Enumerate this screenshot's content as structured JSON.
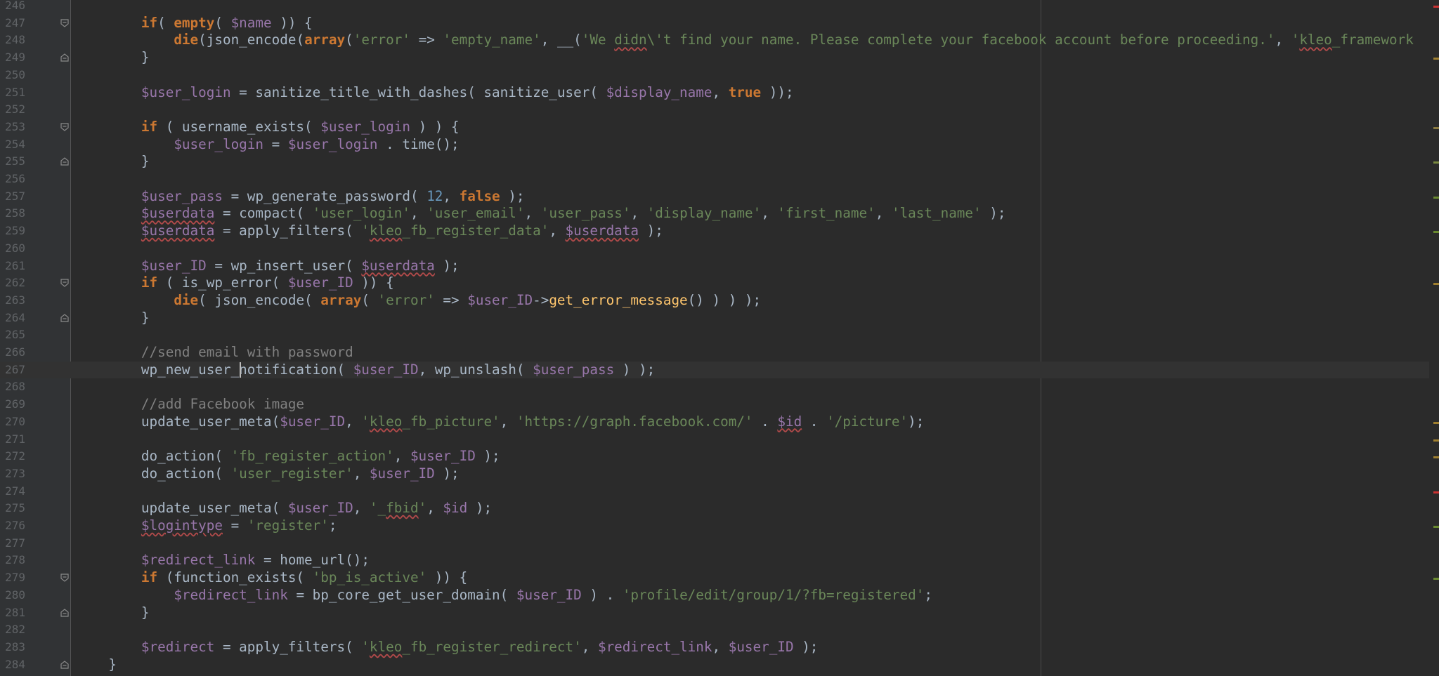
{
  "editor": {
    "lines": [
      {
        "n": "246",
        "fold": "",
        "tokens": []
      },
      {
        "n": "247",
        "fold": "open",
        "tokens": [
          [
            "pl",
            "        "
          ],
          [
            "kw",
            "if"
          ],
          [
            "pl",
            "( "
          ],
          [
            "kw",
            "empty"
          ],
          [
            "pl",
            "( "
          ],
          [
            "var",
            "$name"
          ],
          [
            "pl",
            " )) {"
          ]
        ]
      },
      {
        "n": "248",
        "fold": "",
        "tokens": [
          [
            "pl",
            "            "
          ],
          [
            "kw",
            "die"
          ],
          [
            "pl",
            "(json_encode("
          ],
          [
            "kw",
            "array"
          ],
          [
            "pl",
            "("
          ],
          [
            "str",
            "'error'"
          ],
          [
            "pl",
            " => "
          ],
          [
            "str",
            "'empty_name'"
          ],
          [
            "pl",
            ", __("
          ],
          [
            "str",
            "'We "
          ],
          [
            "str squig",
            "didn"
          ],
          [
            "str",
            "\\'t find your name. Please complete your facebook account before proceeding.'"
          ],
          [
            "pl",
            ", "
          ],
          [
            "str",
            "'"
          ],
          [
            "str squig",
            "kleo"
          ],
          [
            "str",
            "_framework"
          ]
        ]
      },
      {
        "n": "249",
        "fold": "close",
        "tokens": [
          [
            "pl",
            "        }"
          ]
        ]
      },
      {
        "n": "250",
        "fold": "",
        "tokens": []
      },
      {
        "n": "251",
        "fold": "",
        "tokens": [
          [
            "pl",
            "        "
          ],
          [
            "var",
            "$user_login"
          ],
          [
            "pl",
            " = sanitize_title_with_dashes( sanitize_user( "
          ],
          [
            "var",
            "$display_name"
          ],
          [
            "pl",
            ", "
          ],
          [
            "kw",
            "true"
          ],
          [
            "pl",
            " ));"
          ]
        ]
      },
      {
        "n": "252",
        "fold": "",
        "tokens": []
      },
      {
        "n": "253",
        "fold": "open",
        "tokens": [
          [
            "pl",
            "        "
          ],
          [
            "kw",
            "if"
          ],
          [
            "pl",
            " ( username_exists( "
          ],
          [
            "var",
            "$user_login"
          ],
          [
            "pl",
            " ) ) {"
          ]
        ]
      },
      {
        "n": "254",
        "fold": "",
        "tokens": [
          [
            "pl",
            "            "
          ],
          [
            "var",
            "$user_login"
          ],
          [
            "pl",
            " = "
          ],
          [
            "var",
            "$user_login"
          ],
          [
            "pl",
            " . time();"
          ]
        ]
      },
      {
        "n": "255",
        "fold": "close",
        "tokens": [
          [
            "pl",
            "        }"
          ]
        ]
      },
      {
        "n": "256",
        "fold": "",
        "tokens": []
      },
      {
        "n": "257",
        "fold": "",
        "tokens": [
          [
            "pl",
            "        "
          ],
          [
            "var",
            "$user_pass"
          ],
          [
            "pl",
            " = wp_generate_password( "
          ],
          [
            "num",
            "12"
          ],
          [
            "pl",
            ", "
          ],
          [
            "kw",
            "false"
          ],
          [
            "pl",
            " );"
          ]
        ]
      },
      {
        "n": "258",
        "fold": "",
        "tokens": [
          [
            "pl",
            "        "
          ],
          [
            "var squig",
            "$userdata"
          ],
          [
            "pl",
            " = compact( "
          ],
          [
            "str",
            "'user_login'"
          ],
          [
            "pl",
            ", "
          ],
          [
            "str",
            "'user_email'"
          ],
          [
            "pl",
            ", "
          ],
          [
            "str",
            "'user_pass'"
          ],
          [
            "pl",
            ", "
          ],
          [
            "str",
            "'display_name'"
          ],
          [
            "pl",
            ", "
          ],
          [
            "str",
            "'first_name'"
          ],
          [
            "pl",
            ", "
          ],
          [
            "str",
            "'last_name'"
          ],
          [
            "pl",
            " );"
          ]
        ]
      },
      {
        "n": "259",
        "fold": "",
        "tokens": [
          [
            "pl",
            "        "
          ],
          [
            "var squig",
            "$userdata"
          ],
          [
            "pl",
            " = apply_filters( "
          ],
          [
            "str",
            "'"
          ],
          [
            "str squig",
            "kleo"
          ],
          [
            "str",
            "_fb_register_data'"
          ],
          [
            "pl",
            ", "
          ],
          [
            "var squig",
            "$userdata"
          ],
          [
            "pl",
            " );"
          ]
        ]
      },
      {
        "n": "260",
        "fold": "",
        "tokens": []
      },
      {
        "n": "261",
        "fold": "",
        "tokens": [
          [
            "pl",
            "        "
          ],
          [
            "var",
            "$user_ID"
          ],
          [
            "pl",
            " = wp_insert_user( "
          ],
          [
            "var squig",
            "$userdata"
          ],
          [
            "pl",
            " );"
          ]
        ]
      },
      {
        "n": "262",
        "fold": "open",
        "tokens": [
          [
            "pl",
            "        "
          ],
          [
            "kw",
            "if"
          ],
          [
            "pl",
            " ( is_wp_error( "
          ],
          [
            "var",
            "$user_ID"
          ],
          [
            "pl",
            " )) {"
          ]
        ]
      },
      {
        "n": "263",
        "fold": "",
        "tokens": [
          [
            "pl",
            "            "
          ],
          [
            "kw",
            "die"
          ],
          [
            "pl",
            "( json_encode( "
          ],
          [
            "kw",
            "array"
          ],
          [
            "pl",
            "( "
          ],
          [
            "str",
            "'error'"
          ],
          [
            "pl",
            " => "
          ],
          [
            "var",
            "$user_ID"
          ],
          [
            "pl",
            "->"
          ],
          [
            "fn",
            "get_error_message"
          ],
          [
            "pl",
            "() ) ) );"
          ]
        ]
      },
      {
        "n": "264",
        "fold": "close",
        "tokens": [
          [
            "pl",
            "        }"
          ]
        ]
      },
      {
        "n": "265",
        "fold": "",
        "tokens": []
      },
      {
        "n": "266",
        "fold": "",
        "tokens": [
          [
            "pl",
            "        "
          ],
          [
            "com",
            "//send email with password"
          ]
        ]
      },
      {
        "n": "267",
        "fold": "",
        "caret": true,
        "tokens": [
          [
            "pl",
            "        wp_new_user_notification( "
          ],
          [
            "var",
            "$user_ID"
          ],
          [
            "pl",
            ", wp_unslash( "
          ],
          [
            "var",
            "$user_pass"
          ],
          [
            "pl",
            " ) );"
          ]
        ]
      },
      {
        "n": "268",
        "fold": "",
        "tokens": []
      },
      {
        "n": "269",
        "fold": "",
        "tokens": [
          [
            "pl",
            "        "
          ],
          [
            "com",
            "//add Facebook image"
          ]
        ]
      },
      {
        "n": "270",
        "fold": "",
        "tokens": [
          [
            "pl",
            "        update_user_meta("
          ],
          [
            "var",
            "$user_ID"
          ],
          [
            "pl",
            ", "
          ],
          [
            "str",
            "'"
          ],
          [
            "str squig",
            "kleo"
          ],
          [
            "str",
            "_fb_picture'"
          ],
          [
            "pl",
            ", "
          ],
          [
            "str",
            "'https://graph.facebook.com/'"
          ],
          [
            "pl",
            " . "
          ],
          [
            "var squig",
            "$id"
          ],
          [
            "pl",
            " . "
          ],
          [
            "str",
            "'/picture'"
          ],
          [
            "pl",
            ");"
          ]
        ]
      },
      {
        "n": "271",
        "fold": "",
        "tokens": []
      },
      {
        "n": "272",
        "fold": "",
        "tokens": [
          [
            "pl",
            "        do_action( "
          ],
          [
            "str",
            "'fb_register_action'"
          ],
          [
            "pl",
            ", "
          ],
          [
            "var",
            "$user_ID"
          ],
          [
            "pl",
            " );"
          ]
        ]
      },
      {
        "n": "273",
        "fold": "",
        "tokens": [
          [
            "pl",
            "        do_action( "
          ],
          [
            "str",
            "'user_register'"
          ],
          [
            "pl",
            ", "
          ],
          [
            "var",
            "$user_ID"
          ],
          [
            "pl",
            " );"
          ]
        ]
      },
      {
        "n": "274",
        "fold": "",
        "tokens": []
      },
      {
        "n": "275",
        "fold": "",
        "tokens": [
          [
            "pl",
            "        update_user_meta( "
          ],
          [
            "var",
            "$user_ID"
          ],
          [
            "pl",
            ", "
          ],
          [
            "str",
            "'_"
          ],
          [
            "str squig",
            "fbid"
          ],
          [
            "str",
            "'"
          ],
          [
            "pl",
            ", "
          ],
          [
            "var",
            "$id"
          ],
          [
            "pl",
            " );"
          ]
        ]
      },
      {
        "n": "276",
        "fold": "",
        "tokens": [
          [
            "pl",
            "        "
          ],
          [
            "var squig",
            "$logintype"
          ],
          [
            "pl",
            " = "
          ],
          [
            "str",
            "'register'"
          ],
          [
            "pl",
            ";"
          ]
        ]
      },
      {
        "n": "277",
        "fold": "",
        "tokens": []
      },
      {
        "n": "278",
        "fold": "",
        "tokens": [
          [
            "pl",
            "        "
          ],
          [
            "var",
            "$redirect_link"
          ],
          [
            "pl",
            " = home_url();"
          ]
        ]
      },
      {
        "n": "279",
        "fold": "open",
        "tokens": [
          [
            "pl",
            "        "
          ],
          [
            "kw",
            "if"
          ],
          [
            "pl",
            " (function_exists( "
          ],
          [
            "str",
            "'bp_is_active'"
          ],
          [
            "pl",
            " )) {"
          ]
        ]
      },
      {
        "n": "280",
        "fold": "",
        "tokens": [
          [
            "pl",
            "            "
          ],
          [
            "var",
            "$redirect_link"
          ],
          [
            "pl",
            " = bp_core_get_user_domain( "
          ],
          [
            "var",
            "$user_ID"
          ],
          [
            "pl",
            " ) . "
          ],
          [
            "str",
            "'profile/edit/group/1/?fb=registered'"
          ],
          [
            "pl",
            ";"
          ]
        ]
      },
      {
        "n": "281",
        "fold": "close",
        "tokens": [
          [
            "pl",
            "        }"
          ]
        ]
      },
      {
        "n": "282",
        "fold": "",
        "tokens": []
      },
      {
        "n": "283",
        "fold": "",
        "tokens": [
          [
            "pl",
            "        "
          ],
          [
            "var",
            "$redirect"
          ],
          [
            "pl",
            " = apply_filters( "
          ],
          [
            "str",
            "'"
          ],
          [
            "str squig",
            "kleo"
          ],
          [
            "str",
            "_fb_register_redirect'"
          ],
          [
            "pl",
            ", "
          ],
          [
            "var",
            "$redirect_link"
          ],
          [
            "pl",
            ", "
          ],
          [
            "var",
            "$user_ID"
          ],
          [
            "pl",
            " );"
          ]
        ]
      },
      {
        "n": "284",
        "fold": "close",
        "tokens": [
          [
            "pl",
            "    }"
          ]
        ]
      }
    ],
    "scroll_marks": [
      {
        "row": 0,
        "color": "#cc3333"
      },
      {
        "row": 3,
        "color": "#a08030"
      },
      {
        "row": 7,
        "color": "#8a7a40"
      },
      {
        "row": 9,
        "color": "#7a8a40"
      },
      {
        "row": 11,
        "color": "#6a8a30"
      },
      {
        "row": 13,
        "color": "#6a8a30"
      },
      {
        "row": 16,
        "color": "#a08030"
      },
      {
        "row": 24,
        "color": "#a08030"
      },
      {
        "row": 25,
        "color": "#a08030"
      },
      {
        "row": 26,
        "color": "#a08030"
      },
      {
        "row": 28,
        "color": "#cc3333"
      },
      {
        "row": 30,
        "color": "#6a8a30"
      },
      {
        "row": 33,
        "color": "#6a8a30"
      }
    ]
  }
}
